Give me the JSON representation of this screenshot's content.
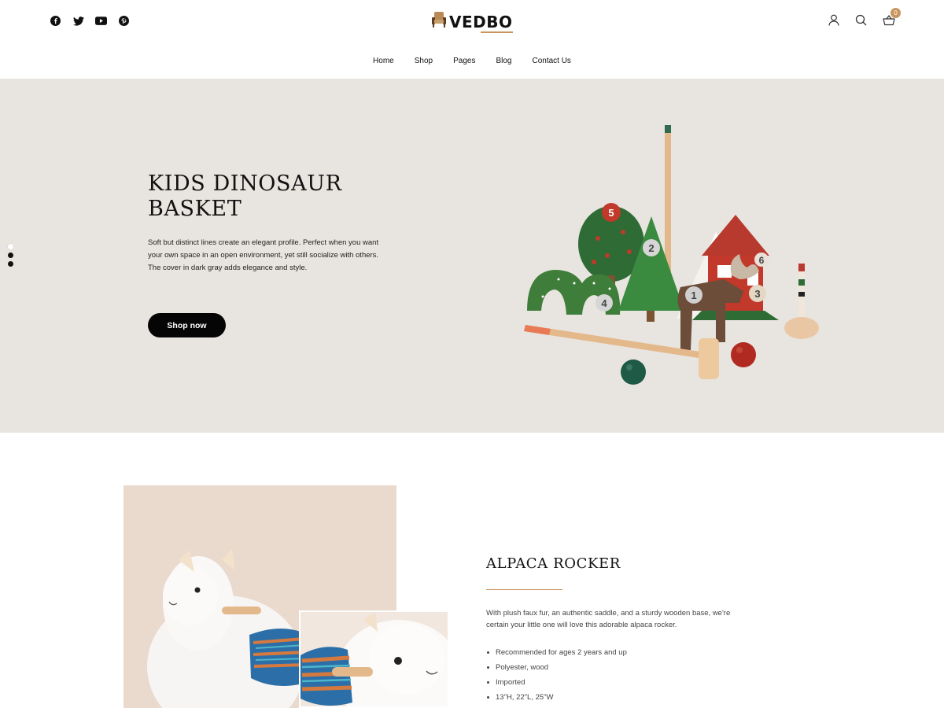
{
  "header": {
    "social": [
      {
        "icon": "facebook-icon"
      },
      {
        "icon": "twitter-icon"
      },
      {
        "icon": "youtube-icon"
      },
      {
        "icon": "pinterest-icon"
      }
    ],
    "logo_text": "VEDBO",
    "cart_count": "0",
    "accent_color": "#c8955e"
  },
  "nav": {
    "items": [
      "Home",
      "Shop",
      "Pages",
      "Blog",
      "Contact Us"
    ]
  },
  "hero": {
    "title": "KIDS DINOSAUR BASKET",
    "description": "Soft but distinct lines create an elegant profile. Perfect when you want your own space in an open environment, yet still socialize with others. The cover in dark gray adds elegance and style.",
    "button_label": "Shop now",
    "background": "#e8e4df",
    "slides": 3,
    "active_slide": 1,
    "art_numbers": [
      "5",
      "2",
      "6",
      "4",
      "1",
      "3"
    ]
  },
  "product": {
    "title": "ALPACA ROCKER",
    "description": "With plush faux fur, an authentic saddle, and a sturdy wooden base, we're certain your little one will love this adorable alpaca rocker.",
    "features": [
      "Recommended for ages 2 years and up",
      "Polyester, wood",
      "Imported",
      "13\"H, 22\"L, 25\"W"
    ]
  }
}
